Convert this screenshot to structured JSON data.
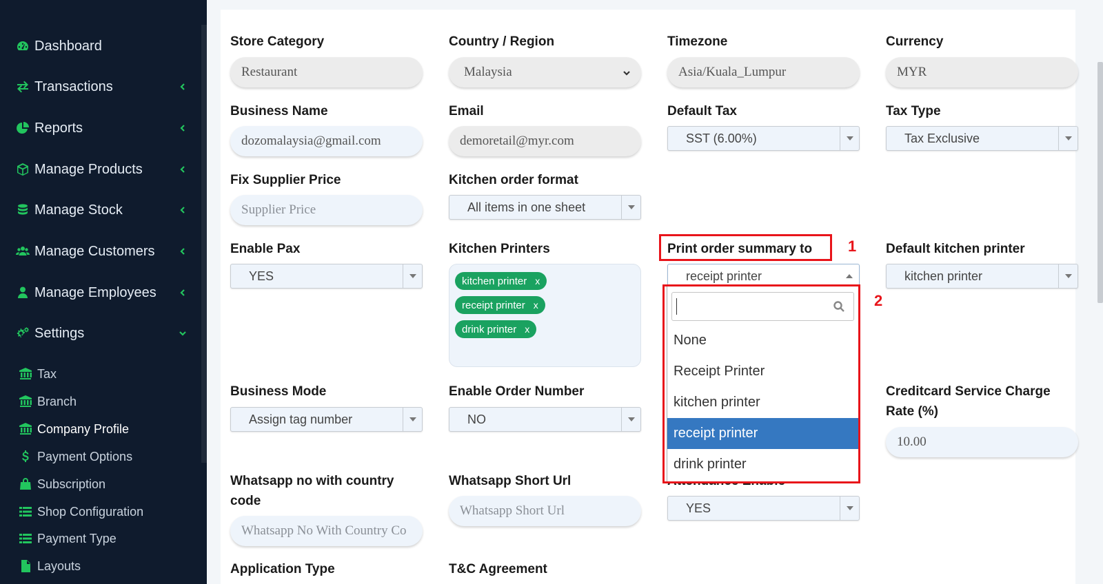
{
  "sidebar": {
    "items": [
      {
        "label": "Dashboard",
        "icon": "dashboard-icon",
        "chevron": "none"
      },
      {
        "label": "Transactions",
        "icon": "exchange-icon",
        "chevron": "left"
      },
      {
        "label": "Reports",
        "icon": "pie-chart-icon",
        "chevron": "left"
      },
      {
        "label": "Manage Products",
        "icon": "cube-icon",
        "chevron": "left"
      },
      {
        "label": "Manage Stock",
        "icon": "database-icon",
        "chevron": "left"
      },
      {
        "label": "Manage Customers",
        "icon": "users-icon",
        "chevron": "left"
      },
      {
        "label": "Manage Employees",
        "icon": "user-icon",
        "chevron": "left"
      },
      {
        "label": "Settings",
        "icon": "gears-icon",
        "chevron": "down"
      }
    ],
    "settings_subitems": [
      {
        "label": "Tax",
        "icon": "bank-icon"
      },
      {
        "label": "Branch",
        "icon": "bank-icon"
      },
      {
        "label": "Company Profile",
        "icon": "bank-icon",
        "active": true
      },
      {
        "label": "Payment Options",
        "icon": "dollar-icon"
      },
      {
        "label": "Subscription",
        "icon": "shopping-bag-icon"
      },
      {
        "label": "Shop Configuration",
        "icon": "list-icon"
      },
      {
        "label": "Payment Type",
        "icon": "list-icon"
      },
      {
        "label": "Layouts",
        "icon": "file-icon"
      }
    ]
  },
  "form": {
    "store_category": {
      "label": "Store Category",
      "value": "Restaurant"
    },
    "country": {
      "label": "Country / Region",
      "value": "Malaysia"
    },
    "timezone": {
      "label": "Timezone",
      "value": "Asia/Kuala_Lumpur"
    },
    "currency": {
      "label": "Currency",
      "value": "MYR"
    },
    "business_name": {
      "label": "Business Name",
      "value": "dozomalaysia@gmail.com"
    },
    "email": {
      "label": "Email",
      "value": "demoretail@myr.com"
    },
    "default_tax": {
      "label": "Default Tax",
      "value": "SST (6.00%)"
    },
    "tax_type": {
      "label": "Tax Type",
      "value": "Tax Exclusive"
    },
    "fix_supplier_price": {
      "label": "Fix Supplier Price",
      "placeholder": "Supplier Price"
    },
    "kitchen_order_format": {
      "label": "Kitchen order format",
      "value": "All items in one sheet"
    },
    "enable_pax": {
      "label": "Enable Pax",
      "value": "YES"
    },
    "kitchen_printers": {
      "label": "Kitchen Printers",
      "tags": [
        "kitchen printer",
        "receipt printer",
        "drink printer"
      ],
      "remove_symbol": "x"
    },
    "print_order_summary": {
      "label": "Print order summary to",
      "value": "receipt printer"
    },
    "default_kitchen_printer": {
      "label": "Default kitchen printer",
      "value": "kitchen printer"
    },
    "business_mode": {
      "label": "Business Mode",
      "value": "Assign tag number"
    },
    "enable_order_number": {
      "label": "Enable Order Number",
      "value": "NO"
    },
    "creditcard_rate": {
      "label_line1": "Creditcard Service Charge",
      "label_line2": "Rate (%)",
      "value": "10.00"
    },
    "whatsapp_no": {
      "label_line1": "Whatsapp no with country",
      "label_line2": "code",
      "placeholder": "Whatsapp No With Country Co"
    },
    "whatsapp_url": {
      "label": "Whatsapp Short Url",
      "placeholder": "Whatsapp Short Url"
    },
    "attendance_enable": {
      "label": "Attendance Enable",
      "value": "YES"
    },
    "application_type": {
      "label": "Application Type"
    },
    "tc_agreement": {
      "label": "T&C Agreement"
    }
  },
  "dropdown": {
    "search_value": "",
    "options": [
      "None",
      "Receipt Printer",
      "kitchen printer",
      "receipt printer",
      "drink printer"
    ],
    "highlighted_index": 3
  },
  "annotations": {
    "num1": "1",
    "num2": "2",
    "color": "#e8141a"
  },
  "colors": {
    "sidebar_bg": "#0f1b2d",
    "accent_green": "#22c55e",
    "tag_green": "#1aa260",
    "highlight_blue": "#3578c1"
  }
}
